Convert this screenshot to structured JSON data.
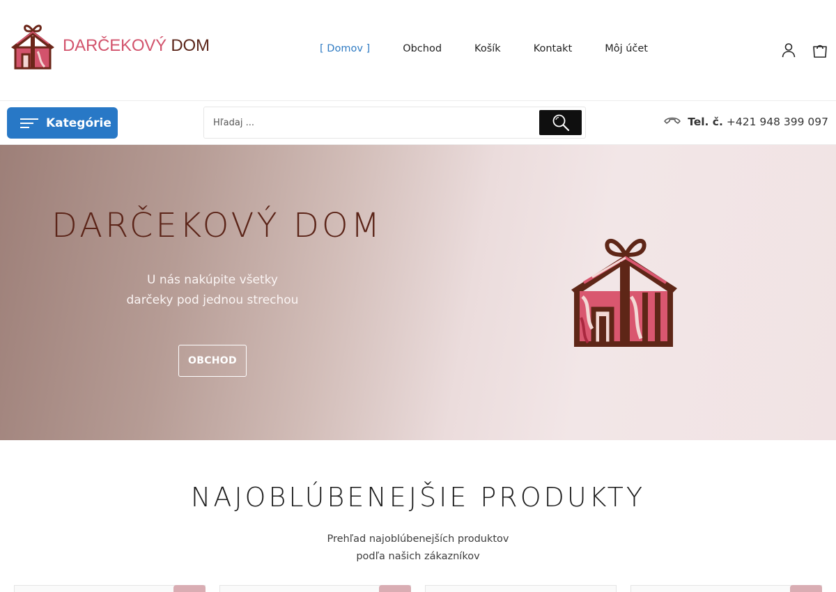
{
  "logo": {
    "part1": "DARČEKOVÝ",
    "part2": "DOM",
    "icon": "gift-house-logo"
  },
  "nav": {
    "items": [
      {
        "label": "Domov",
        "active": true
      },
      {
        "label": "Obchod"
      },
      {
        "label": "Košík"
      },
      {
        "label": "Kontakt"
      },
      {
        "label": "Môj účet"
      }
    ]
  },
  "header_icons": [
    "user-icon",
    "shopping-bag-icon"
  ],
  "toolbar": {
    "categories_label": "Kategórie",
    "search_placeholder": "Hľadaj ...",
    "phone_label": "Tel. č.",
    "phone_number": "+421 948 399 097"
  },
  "hero": {
    "title": "DARČEKOVÝ DOM",
    "subtitle_line1": "U nás nakúpite všetky",
    "subtitle_line2": "darčeky pod jednou strechou",
    "button": "OBCHOD"
  },
  "products_section": {
    "title": "NAJOBLÚBENEJŠIE PRODUKTY",
    "subtitle_line1": "Prehľad najoblúbenejších produktov",
    "subtitle_line2": "podľa našich zákazníkov"
  },
  "colors": {
    "accent_blue": "#2878c6",
    "brand_pink": "#d2536c",
    "brand_brown": "#5a2418"
  }
}
